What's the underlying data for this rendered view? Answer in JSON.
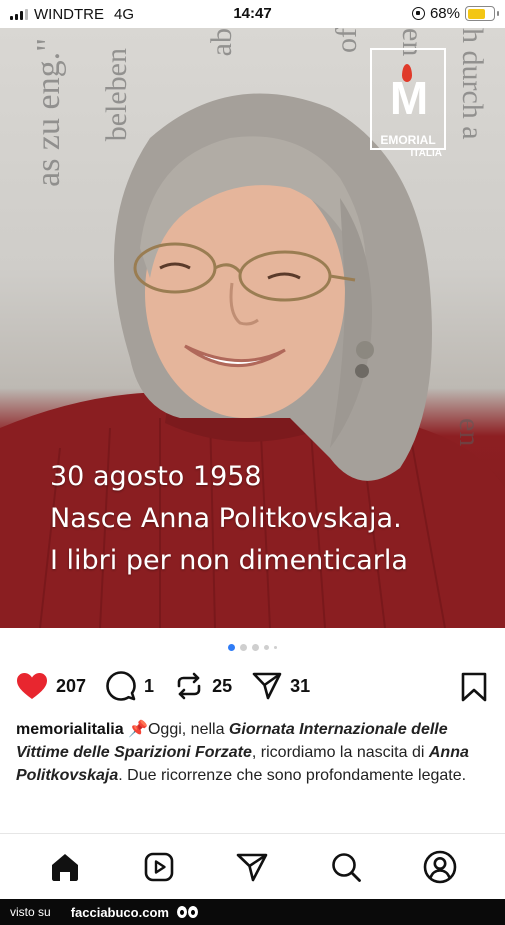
{
  "status_bar": {
    "carrier": "WINDTRE",
    "network": "4G",
    "time": "14:47",
    "battery": "68%",
    "battery_level": 0.68
  },
  "post": {
    "logo": {
      "letter": "M",
      "name": "EMORIAL",
      "sub": "ITALIA"
    },
    "background_words": [
      "as zu eng.\"",
      "beleben",
      "ab",
      "of",
      "en",
      "h durch a",
      "en"
    ],
    "overlay_lines": [
      "30 agosto 1958",
      "Nasce Anna Politkovskaja.",
      "I libri per non dimenticarla"
    ],
    "carousel": {
      "count": 5,
      "active_index": 0
    }
  },
  "actions": {
    "likes": "207",
    "comments": "1",
    "reposts": "25",
    "shares": "31"
  },
  "caption": {
    "username": "memorialitalia",
    "pin_emoji": "📌",
    "t1": "Oggi, nella ",
    "e1": "Giornata Internazionale delle Vittime delle Sparizioni Forzate",
    "t2": ", ricordiamo la nascita di ",
    "e2": "Anna Politkovskaja",
    "t3": ". Due ricorrenze che sono profondamente legate."
  },
  "footer": {
    "prefix": "visto su",
    "site": "facciabuco.com"
  },
  "colors": {
    "heart": "#e8262f",
    "sweater": "#8d1f22",
    "active_dot": "#2f7cf6",
    "battery": "#f3c614"
  }
}
